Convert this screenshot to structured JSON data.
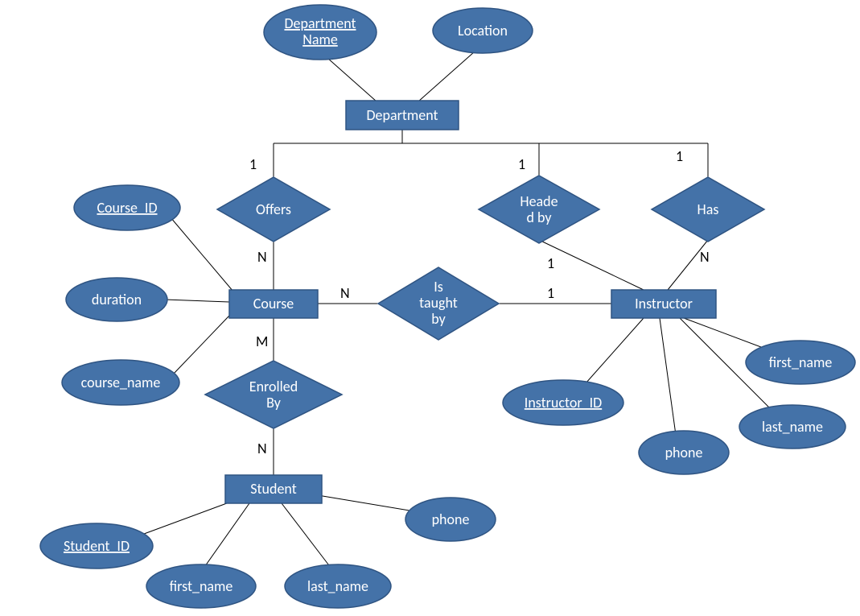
{
  "entities": {
    "department": "Department",
    "course": "Course",
    "instructor": "Instructor",
    "student": "Student"
  },
  "relationships": {
    "offers": "Offers",
    "headed_by_l1": "Heade",
    "headed_by_l2": "d by",
    "has": "Has",
    "is_taught_by_l1": "Is",
    "is_taught_by_l2": "taught",
    "is_taught_by_l3": "by",
    "enrolled_by_l1": "Enrolled",
    "enrolled_by_l2": "By"
  },
  "attributes": {
    "department_name_l1": "Department",
    "department_name_l2": "Name",
    "location": "Location",
    "course_id": "Course_ID",
    "duration": "duration",
    "course_name": "course_name",
    "instructor_id": "Instructor_ID",
    "first_name_i": "first_name",
    "last_name_i": "last_name",
    "phone_i": "phone",
    "student_id": "Student_ID",
    "first_name_s": "first_name",
    "last_name_s": "last_name",
    "phone_s": "phone"
  },
  "cardinalities": {
    "dep_offers": "1",
    "offers_course": "N",
    "dep_headed": "1",
    "headed_instr": "1",
    "dep_has": "1",
    "has_instr": "N",
    "course_taught": "N",
    "taught_instr": "1",
    "course_enrolled": "M",
    "enrolled_student": "N"
  }
}
